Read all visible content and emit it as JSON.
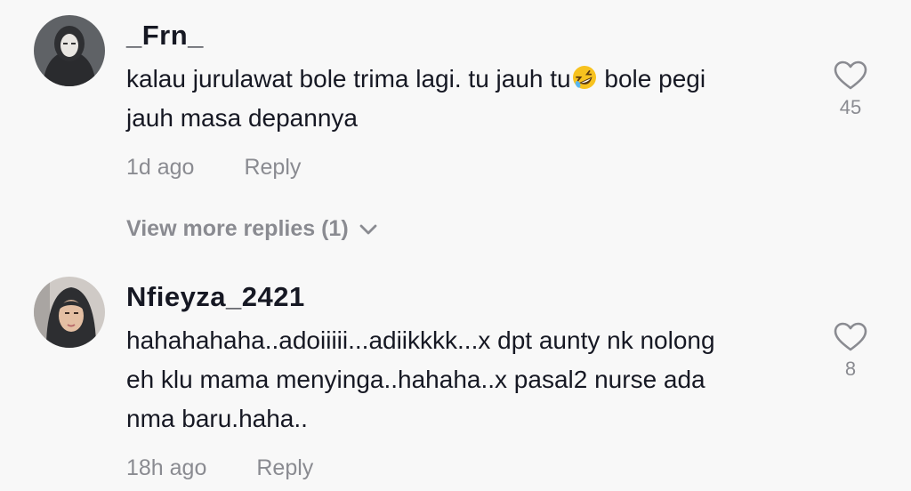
{
  "comments": [
    {
      "username": "_Frn_",
      "text_line1_a": "kalau jurulawat bole trima lagi. tu jauh tu",
      "emoji": "rolling-on-floor-laughing",
      "text_line1_b": " bole pegi",
      "text_line2": "jauh masa depannya",
      "time": "1d ago",
      "reply_label": "Reply",
      "likes": "45"
    },
    {
      "username": "Nfieyza_2421",
      "text_line1": "hahahahaha..adoiiiii...adiikkkk...x dpt aunty nk nolong",
      "text_line2": "eh klu mama menyinga..hahaha..x pasal2 nurse ada",
      "text_line3": "nma baru.haha..",
      "time": "18h ago",
      "reply_label": "Reply",
      "likes": "8"
    }
  ],
  "view_more": {
    "label": "View more replies (1)",
    "icon": "chevron-down-icon"
  },
  "icons": {
    "like": "heart-outline-icon"
  },
  "colors": {
    "background": "#f8f8f8",
    "text": "#161823",
    "secondary": "#8a8b91"
  }
}
